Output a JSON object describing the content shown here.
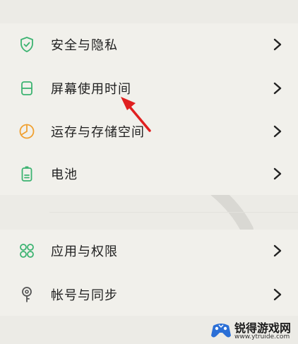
{
  "settings": {
    "group1": [
      {
        "label": "安全与隐私",
        "icon": "shield-check-icon"
      },
      {
        "label": "屏幕使用时间",
        "icon": "hourglass-icon"
      },
      {
        "label": "运存与存储空间",
        "icon": "pie-chart-icon"
      },
      {
        "label": "电池",
        "icon": "battery-icon"
      }
    ],
    "group2": [
      {
        "label": "应用与权限",
        "icon": "app-grid-icon"
      },
      {
        "label": "帐号与同步",
        "icon": "key-icon"
      }
    ]
  },
  "watermark": {
    "title": "锐得游戏网",
    "url": "www.ytruide.com"
  },
  "colors": {
    "accent": "#3cb371",
    "orange": "#f0a030",
    "arrow": "#e02020"
  }
}
